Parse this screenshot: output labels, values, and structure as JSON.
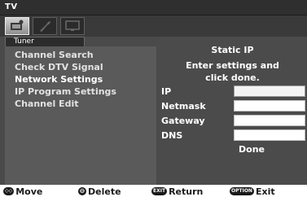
{
  "window": {
    "title": "TV"
  },
  "tabs": [
    {
      "icon": "tv-settings-icon",
      "active": true
    },
    {
      "icon": "wrench-icon",
      "active": false
    },
    {
      "icon": "screen-icon",
      "active": false
    }
  ],
  "menu": {
    "header": "Tuner",
    "items": [
      {
        "label": "Channel Search",
        "selected": false
      },
      {
        "label": "Check DTV Signal",
        "selected": false
      },
      {
        "label": "Network Settings",
        "selected": true
      },
      {
        "label": "IP Program Settings",
        "selected": false
      },
      {
        "label": "Channel Edit",
        "selected": false
      }
    ]
  },
  "panel": {
    "title": "Static IP",
    "instruction_line1": "Enter settings and",
    "instruction_line2": "click done.",
    "fields": [
      {
        "label": "IP",
        "value": ""
      },
      {
        "label": "Netmask",
        "value": ""
      },
      {
        "label": "Gateway",
        "value": ""
      },
      {
        "label": "DNS",
        "value": ""
      }
    ],
    "done_label": "Done"
  },
  "footer": {
    "move": {
      "key": "◇◇",
      "label": "Move"
    },
    "delete": {
      "key": "⊖",
      "label": "Delete"
    },
    "return": {
      "key": "EXIT",
      "label": "Return"
    },
    "exit": {
      "key": "OPTION",
      "label": "Exit"
    }
  }
}
